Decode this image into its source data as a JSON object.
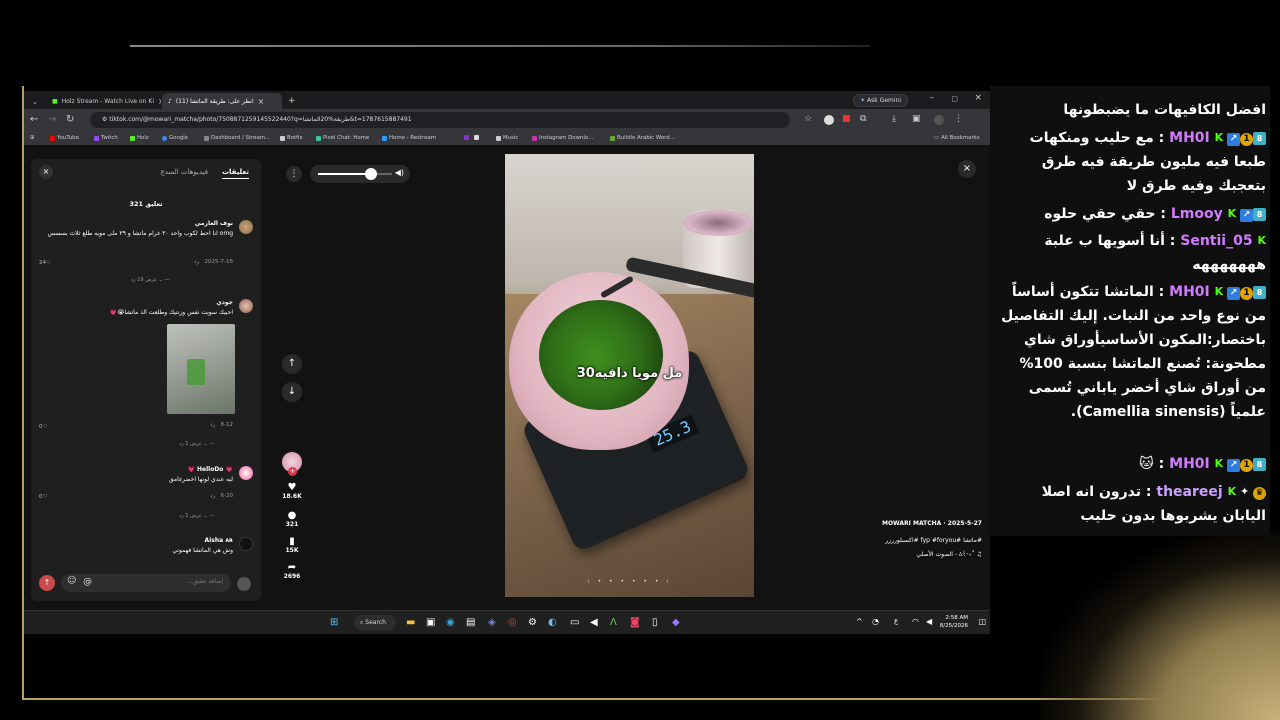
{
  "browser": {
    "tabs": [
      {
        "label": "Holz Stream - Watch Live on Ki"
      },
      {
        "label": "(11) انظر على: طريقة الماتشا"
      }
    ],
    "ask_gemini": "Ask Gemini",
    "url": "tiktok.com/@mowari_matcha/photo/7508871259145522440?q=طريقة%20الماتشا&t=1787615887491",
    "bookmarks": [
      "YouTube",
      "Twitch",
      "Holz",
      "Google",
      "Dashboard / Stream...",
      "Botfix",
      "Pixel Chat: Home",
      "Home - Restream",
      "Music",
      "Instagram Downlo...",
      "Buildle Arabic Word..."
    ],
    "all_bookmarks": "All Bookmarks"
  },
  "comments": {
    "tab_comments": "تعليقات",
    "tab_creator_videos": "فيديوهات المبدع",
    "count": "321 تعليق",
    "items": [
      {
        "name": "نوف العازمي",
        "text": "omg انا احط لكوب واحد ٣٠ غرام ماتشا و ٣٩ ملى مويه طلع ثلاث بسسس",
        "date": "2025-7-16",
        "reply": "رد",
        "likes": "24",
        "view_replies": "عرض 19 رد"
      },
      {
        "name": "جودي",
        "text": "احبيك سويت نفس وزنتيك وطلعت الذ ماتشا😭💗",
        "date": "8-12",
        "reply": "رد",
        "likes": "0",
        "view_replies": "عرض 1 رد"
      },
      {
        "name": "💗 HelloDo 💗",
        "text": "ليه عندي لونها اخضرغامق",
        "date": "6-20",
        "reply": "رد",
        "likes": "0",
        "view_replies": "عرض 1 رد"
      },
      {
        "name": "Aisha ᴀʀ",
        "text": "وش هي الماتشا فهموني",
        "date": "",
        "reply": "",
        "likes": "",
        "view_replies": ""
      }
    ],
    "input_placeholder": "إضافة تعليق..."
  },
  "video": {
    "overlay_text": "30مل مويا دافيه",
    "scale_reading": "25.3",
    "likes": "18.6K",
    "comments": "321",
    "saves": "15K",
    "shares": "2696",
    "author": "MOWARI MATCHA",
    "date": "2025-5-27",
    "caption": "#ماتشا #fyp #foryou #اكسبلورررر",
    "sound": "♫ ˚₊‧꒰ა - الصوت الأصلي",
    "volume_level": 0.72
  },
  "taskbar": {
    "search": "Search",
    "time": "2:58 AM",
    "date": "8/25/2026"
  },
  "chat": {
    "top_partial": "افضل الكافيهات ما يضبطونها",
    "messages": [
      {
        "user": "MH0I",
        "sep": " : ",
        "text": "مع حليب ومنكهات طبعا فيه مليون طريقة فيه طرق بتعجبك وفيه طرق لا"
      },
      {
        "user": "Lmooy",
        "sep": " : ",
        "text": "حقي حقي حلوه"
      },
      {
        "user": "Sentii_05",
        "sep": " : ",
        "text": "أنا أسويها ب علبة هههههههه"
      },
      {
        "user": "MH0I",
        "sep": " : ",
        "text": "الماتشا تتكون أساساً من نوع واحد من النبات. إليك التفاصيل باختصار:المكون الأساسيأوراق شاي مطحونة: تُصنع الماتشا بنسبة 100% من أوراق شاي أخضر ياباني تُسمى علمياً (Camellia sinensis)."
      },
      {
        "user": "MH0I",
        "sep": " : ",
        "text": "🐱"
      },
      {
        "user": "theareej",
        "sep": " : ",
        "text": "تدرون انه اصلا اليابان يشربوها بدون حليب"
      }
    ],
    "colors": {
      "kick_green": "#53fc18",
      "username": "#d27bff"
    }
  }
}
